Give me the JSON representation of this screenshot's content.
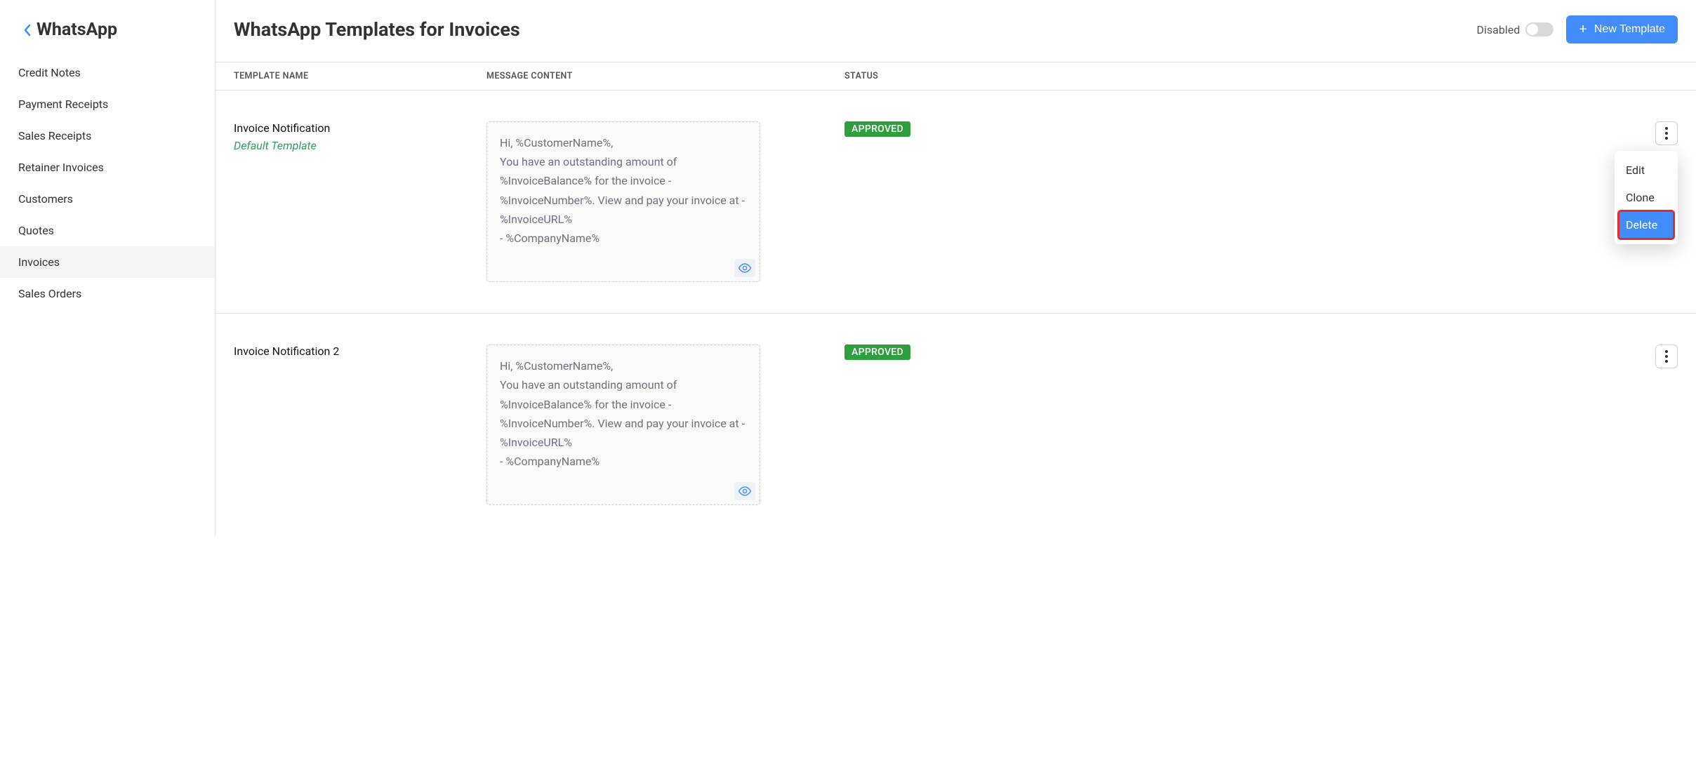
{
  "sidebar": {
    "title": "WhatsApp",
    "items": [
      {
        "label": "Credit Notes",
        "active": false
      },
      {
        "label": "Payment Receipts",
        "active": false
      },
      {
        "label": "Sales Receipts",
        "active": false
      },
      {
        "label": "Retainer Invoices",
        "active": false
      },
      {
        "label": "Customers",
        "active": false
      },
      {
        "label": "Quotes",
        "active": false
      },
      {
        "label": "Invoices",
        "active": true
      },
      {
        "label": "Sales Orders",
        "active": false
      }
    ]
  },
  "header": {
    "title": "WhatsApp Templates for Invoices",
    "toggle_label": "Disabled",
    "new_template_label": "New Template"
  },
  "columns": {
    "name": "TEMPLATE NAME",
    "content": "MESSAGE CONTENT",
    "status": "STATUS"
  },
  "dropdown": {
    "edit": "Edit",
    "clone": "Clone",
    "delete": "Delete"
  },
  "rows": [
    {
      "name": "Invoice Notification",
      "default_label": "Default Template",
      "is_default": true,
      "message": "Hi, %CustomerName%,\nYou have an outstanding amount of %InvoiceBalance% for the invoice - %InvoiceNumber%. View and pay your invoice at - %InvoiceURL%\n- %CompanyName%",
      "status": "APPROVED",
      "menu_open": true
    },
    {
      "name": "Invoice Notification 2",
      "default_label": "",
      "is_default": false,
      "message": "Hi, %CustomerName%,\nYou have an outstanding amount of %InvoiceBalance% for the invoice - %InvoiceNumber%. View and pay your invoice at - %InvoiceURL%\n- %CompanyName%",
      "status": "APPROVED",
      "menu_open": false
    }
  ]
}
